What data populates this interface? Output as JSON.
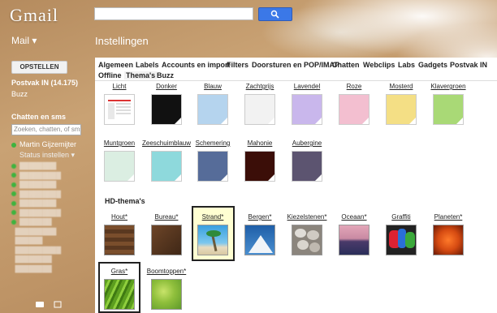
{
  "header": {
    "logo": "Gmail",
    "search": {
      "value": "",
      "placeholder": ""
    }
  },
  "nav": {
    "mail_label": "Mail ▾",
    "page_title": "Instellingen"
  },
  "sidebar": {
    "compose_label": "OPSTELLEN",
    "inbox_label": "Postvak IN (14.175)",
    "buzz_label": "Buzz",
    "chat_heading": "Chatten en sms",
    "chat_search_placeholder": "Zoeken, chatten, of sms",
    "me_name": "Martin Gijzemijter",
    "status_label": "Status instellen ▾"
  },
  "tabs": [
    "Algemeen",
    "Labels",
    "Accounts en import",
    "Filters",
    "Doorsturen en POP/IMAP",
    "Chatten",
    "Webclips",
    "Labs",
    "Gadgets",
    "Postvak IN",
    "Offline",
    "Thema's",
    "Buzz"
  ],
  "active_tab": "Thema's",
  "themes_row1": [
    {
      "label": "Licht",
      "color": "#ffffff"
    },
    {
      "label": "Donker",
      "color": "#111111"
    },
    {
      "label": "Blauw",
      "color": "#b5d4ee"
    },
    {
      "label": "Zachtgrijs",
      "color": "#f2f2f2"
    },
    {
      "label": "Lavendel",
      "color": "#c9b7ec"
    },
    {
      "label": "Roze",
      "color": "#f3bfd0"
    },
    {
      "label": "Mosterd",
      "color": "#f4df85"
    },
    {
      "label": "Klavergroen",
      "color": "#a9d976"
    }
  ],
  "themes_row2": [
    {
      "label": "Muntgroen",
      "color": "#dbeee2"
    },
    {
      "label": "Zeeschuimblauw",
      "color": "#8ed9dc"
    },
    {
      "label": "Schemering",
      "color": "#566c99"
    },
    {
      "label": "Mahonie",
      "color": "#3b0e08"
    },
    {
      "label": "Aubergine",
      "color": "#5c5470"
    }
  ],
  "hd_heading": "HD-thema's",
  "themes_hd1": [
    {
      "label": "Hout*",
      "color": "#6b4426"
    },
    {
      "label": "Bureau*",
      "color": "#5b3a22"
    },
    {
      "label": "Strand*",
      "color": "#4aa7d8"
    },
    {
      "label": "Bergen*",
      "color": "#2f6fb0"
    },
    {
      "label": "Kiezelstenen*",
      "color": "#9a948c"
    },
    {
      "label": "Oceaan*",
      "color": "#c98aa3"
    },
    {
      "label": "Graffiti",
      "color": "#2a2a2a"
    },
    {
      "label": "Planeten*",
      "color": "#d64b12"
    }
  ],
  "themes_hd2": [
    {
      "label": "Gras*",
      "color": "#6cae2a"
    },
    {
      "label": "Boomtoppen*",
      "color": "#9cc84a"
    }
  ],
  "selected_theme": "Strand*"
}
